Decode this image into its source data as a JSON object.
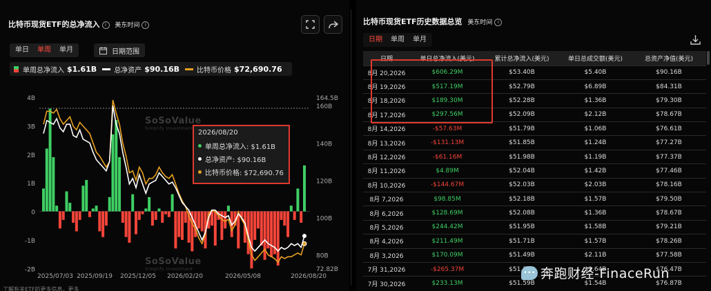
{
  "left_panel": {
    "title": "比特币现货ETF的总净流入",
    "timezone": "美东时间",
    "info_glyph": "i",
    "tabs": [
      "单日",
      "单周",
      "单月"
    ],
    "active_tab": 1,
    "range_label": "日期范围",
    "legend": [
      {
        "label": "单周总净流入",
        "value": "$1.61B"
      },
      {
        "label": "总净资产",
        "value": "$90.16B"
      },
      {
        "label": "比特币价格",
        "value": "$72,690.76"
      }
    ],
    "tooltip": {
      "date": "2026/08/20",
      "rows": [
        "单周总净流入: $1.61B",
        "总净资产: $90.16B",
        "比特币价格: $72,690.76"
      ]
    },
    "watermark": "SoSoValue",
    "watermark_sub": "Simplify Investment",
    "footnote": "了解有关ETF的更多信息，更多"
  },
  "right_panel": {
    "title": "比特币现货ETF历史数据总览",
    "timezone": "美东时间",
    "tabs": [
      "日期",
      "单周",
      "单月"
    ],
    "active_tab": 0,
    "columns": [
      "日期",
      "单日总净流入(美元)",
      "累计总净流入(美元)",
      "单日总成交额(美元)",
      "总资产净值(美元)"
    ],
    "rows": [
      [
        "8月 20,2026",
        "$606.29M",
        "$53.40B",
        "$5.40B",
        "$90.16B"
      ],
      [
        "8月 19,2026",
        "$517.19M",
        "$52.79B",
        "$6.89B",
        "$84.31B"
      ],
      [
        "8月 18,2026",
        "$189.30M",
        "$52.28B",
        "$1.36B",
        "$79.30B"
      ],
      [
        "8月 17,2026",
        "$297.56M",
        "$52.09B",
        "$2.12B",
        "$78.67B"
      ],
      [
        "8月 14,2026",
        "-$57.63M",
        "$51.79B",
        "$1.06B",
        "$76.61B"
      ],
      [
        "8月 13,2026",
        "-$131.13M",
        "$51.85B",
        "$1.24B",
        "$77.27B"
      ],
      [
        "8月 12,2026",
        "-$61.16M",
        "$51.98B",
        "$1.19B",
        "$77.37B"
      ],
      [
        "8月 11,2026",
        "$4.89M",
        "$52.04B",
        "$1.42B",
        "$77.46B"
      ],
      [
        "8月 10,2026",
        "-$144.67M",
        "$52.03B",
        "$2.03B",
        "$78.16B"
      ],
      [
        "8月 7,2026",
        "$98.85M",
        "$52.18B",
        "$1.57B",
        "$79.50B"
      ],
      [
        "8月 6,2026",
        "$128.69M",
        "$52.08B",
        "$1.36B",
        "$78.67B"
      ],
      [
        "8月 5,2026",
        "$244.42M",
        "$51.95B",
        "$1.58B",
        "$79.21B"
      ],
      [
        "8月 4,2026",
        "$211.49M",
        "$51.71B",
        "$1.57B",
        "$78.26B"
      ],
      [
        "8月 3,2026",
        "$170.09M",
        "$51.49B",
        "$2.11B",
        "$77.58B"
      ],
      [
        "7月 31,2026",
        "-$265.37M",
        "$51.32B",
        "$2.64B",
        "$76.47B"
      ],
      [
        "7月 30,2026",
        "$233.13M",
        "$51.59B",
        "$1.54B",
        "$76.87B"
      ]
    ]
  },
  "credit": "奔跑财经-FinaceRun",
  "colors": {
    "positive": "#3fcf64",
    "negative": "#f5453a",
    "asset_line": "#ffffff",
    "price_line": "#e8a020",
    "highlight": "#e03a2f"
  },
  "chart_data": {
    "type": "bar",
    "x_tick_labels": [
      "2025/07/03",
      "2025/09/19",
      "2025/12/05",
      "2026/02/20",
      "2026/05/08",
      "2026/08/20"
    ],
    "y_left_ticks": [
      "4B",
      "3B",
      "2B",
      "1B",
      "0",
      "-1B",
      "-2B"
    ],
    "y_left_range": [
      -2,
      4
    ],
    "y_right_ticks": [
      "164.5B",
      "160B",
      "140B",
      "120B",
      "100B",
      "80B",
      "72.82B"
    ],
    "y_right_range": [
      72.82,
      164.5
    ],
    "series": [
      {
        "name": "单周总净流入",
        "unit": "B",
        "values": [
          0.8,
          2.2,
          3.6,
          1.9,
          0.2,
          -0.6,
          -0.3,
          0.7,
          0.3,
          -0.4,
          -0.7,
          -0.3,
          0.9,
          1.1,
          -0.2,
          0.1,
          0.2,
          -0.7,
          -0.9,
          -0.5,
          0.5,
          2.7,
          3.2,
          1.9,
          -0.4,
          -0.9,
          -1.1,
          0.6,
          -0.8,
          -0.3,
          -0.1,
          0.1,
          0.5,
          -0.5,
          -0.3,
          0.1,
          -0.4,
          -0.1,
          -0.2,
          0.6,
          -1.3,
          -0.9,
          -1.0,
          -0.4,
          -1.1,
          -1.4,
          -0.9,
          -0.6,
          -0.7,
          -1.3,
          -0.6,
          -0.5,
          -1.2,
          -0.3,
          -1.0,
          -0.6,
          0.2,
          -0.9,
          -0.5,
          -1.3,
          -0.2,
          -1.1,
          -1.5,
          -2.0,
          -1.0,
          -0.6,
          -1.2,
          -1.7,
          -1.3,
          -1.6,
          -1.5,
          -1.9,
          -0.3,
          -0.5,
          -0.9,
          0.2,
          -0.3,
          0.8,
          -0.4,
          1.61
        ]
      },
      {
        "name": "总净资产",
        "unit": "B",
        "values": [
          145,
          152,
          151,
          150,
          153,
          148,
          146,
          150,
          150,
          144,
          143,
          147,
          142,
          141,
          140,
          135,
          131,
          129,
          127,
          125,
          130,
          160,
          150,
          145,
          135,
          127,
          118,
          121,
          116,
          123,
          118,
          113,
          118,
          119,
          120,
          124,
          122,
          120,
          118,
          119,
          116,
          112,
          108,
          106,
          104,
          100,
          96,
          92,
          88,
          92,
          100,
          104,
          104,
          102,
          101,
          100,
          101,
          96,
          98,
          102,
          100,
          97,
          90,
          84,
          82,
          84,
          86,
          88,
          86,
          85,
          84,
          82,
          84,
          83,
          84,
          86,
          85,
          86,
          84,
          90.16
        ]
      },
      {
        "name": "比特币价格",
        "unit": "USD",
        "values": [
          150,
          157,
          157,
          156,
          158,
          153,
          150,
          152,
          154,
          149,
          147,
          151,
          149,
          147,
          145,
          140,
          135,
          133,
          130,
          127,
          130,
          163,
          156,
          150,
          140,
          133,
          124,
          125,
          120,
          127,
          124,
          118,
          121,
          121,
          123,
          127,
          124,
          122,
          121,
          123,
          118,
          113,
          109,
          106,
          101,
          97,
          94,
          89,
          86,
          91,
          102,
          104,
          103,
          101,
          99,
          98,
          99,
          93,
          96,
          103,
          99,
          96,
          88,
          80,
          77,
          79,
          81,
          83,
          80,
          79,
          78,
          76,
          79,
          78,
          79,
          79,
          80,
          81,
          80,
          86
        ]
      }
    ]
  }
}
